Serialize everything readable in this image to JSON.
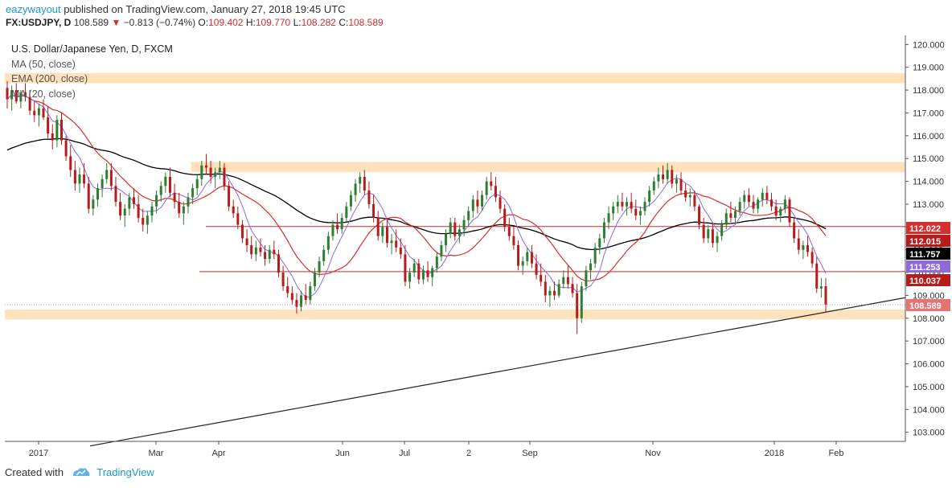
{
  "header": {
    "author": "eazywayout",
    "published_text": "published on TradingView.com, January 27, 2018 19:45 UTC",
    "symbol": "FX:USDJPY, D",
    "last_price": "108.589",
    "change_arrow": "▼",
    "change": "−0.813 (−0.74%)",
    "open_label": "O:",
    "open": "109.402",
    "high_label": "H:",
    "high": "109.770",
    "low_label": "L:",
    "low": "108.282",
    "close_label": "C:",
    "close": "108.589"
  },
  "legend": {
    "title": "U.S. Dollar/Japanese Yen, D, FXCM",
    "items": [
      "MA (50, close)",
      "EMA (200, close)",
      "MA (20, close)"
    ]
  },
  "footer": {
    "created_with": "Created with",
    "brand": "TradingView"
  },
  "colors": {
    "ma50": "#8f6bd6",
    "ema200": "#000000",
    "ma20": "#d32f2f",
    "zone": "#ffe1bc",
    "level": "#cc2a2a",
    "up": "#2e7d32",
    "down": "#b71c1c"
  },
  "chart_data": {
    "type": "candlestick",
    "symbol": "FX:USDJPY",
    "timeframe": "D",
    "x_tick_labels": [
      "2017",
      "Mar",
      "Apr",
      "Jun",
      "Jul",
      "2",
      "Sep",
      "Nov",
      "2018",
      "Feb"
    ],
    "y_ticks": [
      "120.000",
      "119.000",
      "118.000",
      "117.000",
      "116.000",
      "115.000",
      "114.000",
      "113.000",
      "112.000",
      "111.000",
      "110.000",
      "109.000",
      "108.000",
      "107.000",
      "106.000",
      "105.000",
      "104.000",
      "103.000"
    ],
    "ylim": [
      102.6,
      120.4
    ],
    "price_labels": [
      {
        "value": "112.022",
        "color": "#d32f2f",
        "text_color": "#ffffff"
      },
      {
        "value": "112.015",
        "color": "#b71c1c",
        "text_color": "#ffffff"
      },
      {
        "value": "111.757",
        "color": "#000000",
        "text_color": "#ffffff"
      },
      {
        "value": "111.253",
        "color": "#8f6bd6",
        "text_color": "#ffffff"
      },
      {
        "value": "110.037",
        "color": "#b71c1c",
        "text_color": "#ffffff"
      },
      {
        "value": "108.589",
        "color": "#e57373",
        "text_color": "#ffffff"
      }
    ],
    "horizontal_lines": [
      112.02,
      110.04
    ],
    "supply_demand_zones": [
      {
        "from": 118.3,
        "to": 118.75
      },
      {
        "from": 114.4,
        "to": 114.85
      },
      {
        "from": 107.95,
        "to": 108.38
      }
    ],
    "trendline": [
      {
        "date": "Jan 2017",
        "price": 102.4
      },
      {
        "date": "end of visible range",
        "price": 108.9
      }
    ],
    "candles_ohlc": [
      [
        118.1,
        118.4,
        117.2,
        117.6
      ],
      [
        117.6,
        118.2,
        117.1,
        118.0
      ],
      [
        118.0,
        118.3,
        117.4,
        117.5
      ],
      [
        117.5,
        118.0,
        117.2,
        117.9
      ],
      [
        117.9,
        118.3,
        117.5,
        117.7
      ],
      [
        117.7,
        118.0,
        116.9,
        117.1
      ],
      [
        117.1,
        117.5,
        116.6,
        116.9
      ],
      [
        116.9,
        117.4,
        116.4,
        117.2
      ],
      [
        117.2,
        117.6,
        116.7,
        116.8
      ],
      [
        116.8,
        117.3,
        115.9,
        116.1
      ],
      [
        116.1,
        116.5,
        115.4,
        115.8
      ],
      [
        115.8,
        116.9,
        115.5,
        116.7
      ],
      [
        116.7,
        117.0,
        115.6,
        115.8
      ],
      [
        115.8,
        116.0,
        114.9,
        115.1
      ],
      [
        115.1,
        115.6,
        114.2,
        114.5
      ],
      [
        114.5,
        114.9,
        113.6,
        113.9
      ],
      [
        113.9,
        114.6,
        113.5,
        114.3
      ],
      [
        114.3,
        114.8,
        113.7,
        113.9
      ],
      [
        113.9,
        114.2,
        112.6,
        112.8
      ],
      [
        112.8,
        113.4,
        112.5,
        113.2
      ],
      [
        113.2,
        113.9,
        112.9,
        113.7
      ],
      [
        113.7,
        114.3,
        113.3,
        114.1
      ],
      [
        114.1,
        114.8,
        113.9,
        114.5
      ],
      [
        114.5,
        114.8,
        113.6,
        113.8
      ],
      [
        113.8,
        114.2,
        112.9,
        113.1
      ],
      [
        113.1,
        113.5,
        112.3,
        112.5
      ],
      [
        112.5,
        113.0,
        112.0,
        112.8
      ],
      [
        112.8,
        113.5,
        112.5,
        113.3
      ],
      [
        113.3,
        113.7,
        112.8,
        113.0
      ],
      [
        113.0,
        113.4,
        112.2,
        112.4
      ],
      [
        112.4,
        112.8,
        111.8,
        112.1
      ],
      [
        112.1,
        112.7,
        111.7,
        112.5
      ],
      [
        112.5,
        113.1,
        112.2,
        112.9
      ],
      [
        112.9,
        113.6,
        112.6,
        113.4
      ],
      [
        113.4,
        114.0,
        113.1,
        113.8
      ],
      [
        113.8,
        114.4,
        113.5,
        114.2
      ],
      [
        114.2,
        114.6,
        113.3,
        113.5
      ],
      [
        113.5,
        113.9,
        112.8,
        113.1
      ],
      [
        113.1,
        113.5,
        112.4,
        112.6
      ],
      [
        112.6,
        113.1,
        112.1,
        112.9
      ],
      [
        112.9,
        113.5,
        112.6,
        113.3
      ],
      [
        113.3,
        113.9,
        113.0,
        113.7
      ],
      [
        113.7,
        114.3,
        113.4,
        114.1
      ],
      [
        114.1,
        114.9,
        113.8,
        114.7
      ],
      [
        114.7,
        115.2,
        114.3,
        114.6
      ],
      [
        114.6,
        114.9,
        113.9,
        114.2
      ],
      [
        114.2,
        114.6,
        113.7,
        114.4
      ],
      [
        114.4,
        114.9,
        114.1,
        114.6
      ],
      [
        114.6,
        114.8,
        113.6,
        113.8
      ],
      [
        113.8,
        114.0,
        112.7,
        112.9
      ],
      [
        112.9,
        113.2,
        112.4,
        112.6
      ],
      [
        112.6,
        112.9,
        111.9,
        112.1
      ],
      [
        112.1,
        112.3,
        111.3,
        111.5
      ],
      [
        111.5,
        111.9,
        110.9,
        111.2
      ],
      [
        111.2,
        111.6,
        110.6,
        110.8
      ],
      [
        110.8,
        111.4,
        110.5,
        111.1
      ],
      [
        111.1,
        111.5,
        110.7,
        110.9
      ],
      [
        110.9,
        111.2,
        110.3,
        110.6
      ],
      [
        110.6,
        111.2,
        110.4,
        111.0
      ],
      [
        111.0,
        111.4,
        110.6,
        110.8
      ],
      [
        110.8,
        111.0,
        109.8,
        110.0
      ],
      [
        110.0,
        110.3,
        109.2,
        109.4
      ],
      [
        109.4,
        109.8,
        108.9,
        109.1
      ],
      [
        109.1,
        109.4,
        108.6,
        108.8
      ],
      [
        108.8,
        109.1,
        108.2,
        108.5
      ],
      [
        108.5,
        109.2,
        108.3,
        109.0
      ],
      [
        109.0,
        109.5,
        108.6,
        108.8
      ],
      [
        108.8,
        109.6,
        108.6,
        109.4
      ],
      [
        109.4,
        110.2,
        109.2,
        110.0
      ],
      [
        110.0,
        110.7,
        109.8,
        110.5
      ],
      [
        110.5,
        111.2,
        110.3,
        111.0
      ],
      [
        111.0,
        111.8,
        110.8,
        111.6
      ],
      [
        111.6,
        112.3,
        111.4,
        112.1
      ],
      [
        112.1,
        112.6,
        111.7,
        111.9
      ],
      [
        111.9,
        112.6,
        111.7,
        112.4
      ],
      [
        112.4,
        113.1,
        112.2,
        112.9
      ],
      [
        112.9,
        113.6,
        112.7,
        113.4
      ],
      [
        113.4,
        114.1,
        113.1,
        113.9
      ],
      [
        113.9,
        114.4,
        113.5,
        114.2
      ],
      [
        114.2,
        114.5,
        113.4,
        113.6
      ],
      [
        113.6,
        114.0,
        112.8,
        113.0
      ],
      [
        113.0,
        113.4,
        112.2,
        112.4
      ],
      [
        112.4,
        112.7,
        111.4,
        111.6
      ],
      [
        111.6,
        112.2,
        111.3,
        112.0
      ],
      [
        112.0,
        112.4,
        111.1,
        111.3
      ],
      [
        111.3,
        111.7,
        110.8,
        111.4
      ],
      [
        111.4,
        111.9,
        110.9,
        111.1
      ],
      [
        111.1,
        111.5,
        110.6,
        110.8
      ],
      [
        110.8,
        111.2,
        109.4,
        109.6
      ],
      [
        109.6,
        110.2,
        109.3,
        110.0
      ],
      [
        110.0,
        110.6,
        109.8,
        110.4
      ],
      [
        110.4,
        110.6,
        109.5,
        109.7
      ],
      [
        109.7,
        110.3,
        109.5,
        110.1
      ],
      [
        110.1,
        110.5,
        109.6,
        109.8
      ],
      [
        109.8,
        110.3,
        109.4,
        110.2
      ],
      [
        110.2,
        110.9,
        110.0,
        110.7
      ],
      [
        110.7,
        111.4,
        110.5,
        111.2
      ],
      [
        111.2,
        111.9,
        110.9,
        111.7
      ],
      [
        111.7,
        112.4,
        111.5,
        112.2
      ],
      [
        112.2,
        112.4,
        111.4,
        111.6
      ],
      [
        111.6,
        112.1,
        111.3,
        111.9
      ],
      [
        111.9,
        112.5,
        111.6,
        112.3
      ],
      [
        112.3,
        112.9,
        112.0,
        112.7
      ],
      [
        112.7,
        113.4,
        112.4,
        113.2
      ],
      [
        113.2,
        113.6,
        112.6,
        112.9
      ],
      [
        112.9,
        113.6,
        112.7,
        113.4
      ],
      [
        113.4,
        114.2,
        113.2,
        114.0
      ],
      [
        114.0,
        114.4,
        113.6,
        113.8
      ],
      [
        113.8,
        114.2,
        113.1,
        113.3
      ],
      [
        113.3,
        113.6,
        112.6,
        112.8
      ],
      [
        112.8,
        113.0,
        111.8,
        112.0
      ],
      [
        112.0,
        112.4,
        111.4,
        111.6
      ],
      [
        111.6,
        112.0,
        111.0,
        111.2
      ],
      [
        111.2,
        111.4,
        110.1,
        110.3
      ],
      [
        110.3,
        110.7,
        109.9,
        110.5
      ],
      [
        110.5,
        111.1,
        110.3,
        110.9
      ],
      [
        110.9,
        111.2,
        110.2,
        110.4
      ],
      [
        110.4,
        110.8,
        109.7,
        109.9
      ],
      [
        109.9,
        110.4,
        109.4,
        109.6
      ],
      [
        109.6,
        109.9,
        108.7,
        109.0
      ],
      [
        109.0,
        109.4,
        108.5,
        109.2
      ],
      [
        109.2,
        109.6,
        108.8,
        109.0
      ],
      [
        109.0,
        109.7,
        108.9,
        109.5
      ],
      [
        109.5,
        110.1,
        109.3,
        109.8
      ],
      [
        109.8,
        110.3,
        109.3,
        109.5
      ],
      [
        109.5,
        109.8,
        108.9,
        109.1
      ],
      [
        109.1,
        109.5,
        107.3,
        108.0
      ],
      [
        108.0,
        109.6,
        107.8,
        109.4
      ],
      [
        109.4,
        110.3,
        109.2,
        110.1
      ],
      [
        110.1,
        110.6,
        109.7,
        110.4
      ],
      [
        110.4,
        111.3,
        110.2,
        111.1
      ],
      [
        111.1,
        111.7,
        110.8,
        111.5
      ],
      [
        111.5,
        112.4,
        111.3,
        112.2
      ],
      [
        112.2,
        112.9,
        111.9,
        112.6
      ],
      [
        112.6,
        113.1,
        112.3,
        112.9
      ],
      [
        112.9,
        113.4,
        112.6,
        113.1
      ],
      [
        113.1,
        113.5,
        112.7,
        112.9
      ],
      [
        112.9,
        113.3,
        112.5,
        113.1
      ],
      [
        113.1,
        113.5,
        112.6,
        112.8
      ],
      [
        112.8,
        113.2,
        112.3,
        112.5
      ],
      [
        112.5,
        112.9,
        112.1,
        112.7
      ],
      [
        112.7,
        113.3,
        112.5,
        113.1
      ],
      [
        113.1,
        113.8,
        112.9,
        113.6
      ],
      [
        113.6,
        114.2,
        113.4,
        114.0
      ],
      [
        114.0,
        114.6,
        113.7,
        114.3
      ],
      [
        114.3,
        114.7,
        113.9,
        114.1
      ],
      [
        114.1,
        114.8,
        113.9,
        114.5
      ],
      [
        114.5,
        114.7,
        113.7,
        113.9
      ],
      [
        113.9,
        114.3,
        113.5,
        114.1
      ],
      [
        114.1,
        114.4,
        113.4,
        113.6
      ],
      [
        113.6,
        113.9,
        113.1,
        113.3
      ],
      [
        113.3,
        113.7,
        112.9,
        113.4
      ],
      [
        113.4,
        113.6,
        112.7,
        112.9
      ],
      [
        112.9,
        113.0,
        111.9,
        112.1
      ],
      [
        112.1,
        112.4,
        111.3,
        111.5
      ],
      [
        111.5,
        112.1,
        111.3,
        111.9
      ],
      [
        111.9,
        112.2,
        111.1,
        111.3
      ],
      [
        111.3,
        111.8,
        110.9,
        111.6
      ],
      [
        111.6,
        112.3,
        111.4,
        112.1
      ],
      [
        112.1,
        112.8,
        111.9,
        112.6
      ],
      [
        112.6,
        113.1,
        112.2,
        112.4
      ],
      [
        112.4,
        112.9,
        112.1,
        112.7
      ],
      [
        112.7,
        113.3,
        112.5,
        113.1
      ],
      [
        113.1,
        113.6,
        112.8,
        113.4
      ],
      [
        113.4,
        113.7,
        112.9,
        113.1
      ],
      [
        113.1,
        113.4,
        112.6,
        112.8
      ],
      [
        112.8,
        113.3,
        112.6,
        113.2
      ],
      [
        113.2,
        113.7,
        112.9,
        113.5
      ],
      [
        113.5,
        113.8,
        113.0,
        113.2
      ],
      [
        113.2,
        113.5,
        112.7,
        112.9
      ],
      [
        112.9,
        113.2,
        112.3,
        112.5
      ],
      [
        112.5,
        112.9,
        112.2,
        112.8
      ],
      [
        112.8,
        113.4,
        112.6,
        113.2
      ],
      [
        113.2,
        113.3,
        112.0,
        112.2
      ],
      [
        112.2,
        112.4,
        111.3,
        111.5
      ],
      [
        111.5,
        111.9,
        110.8,
        111.0
      ],
      [
        111.0,
        111.4,
        110.6,
        111.2
      ],
      [
        111.2,
        111.6,
        110.7,
        110.9
      ],
      [
        110.9,
        111.1,
        110.2,
        110.4
      ],
      [
        110.4,
        110.7,
        109.1,
        109.3
      ],
      [
        109.3,
        109.77,
        108.9,
        109.4
      ],
      [
        109.402,
        109.77,
        108.282,
        108.589
      ]
    ]
  }
}
